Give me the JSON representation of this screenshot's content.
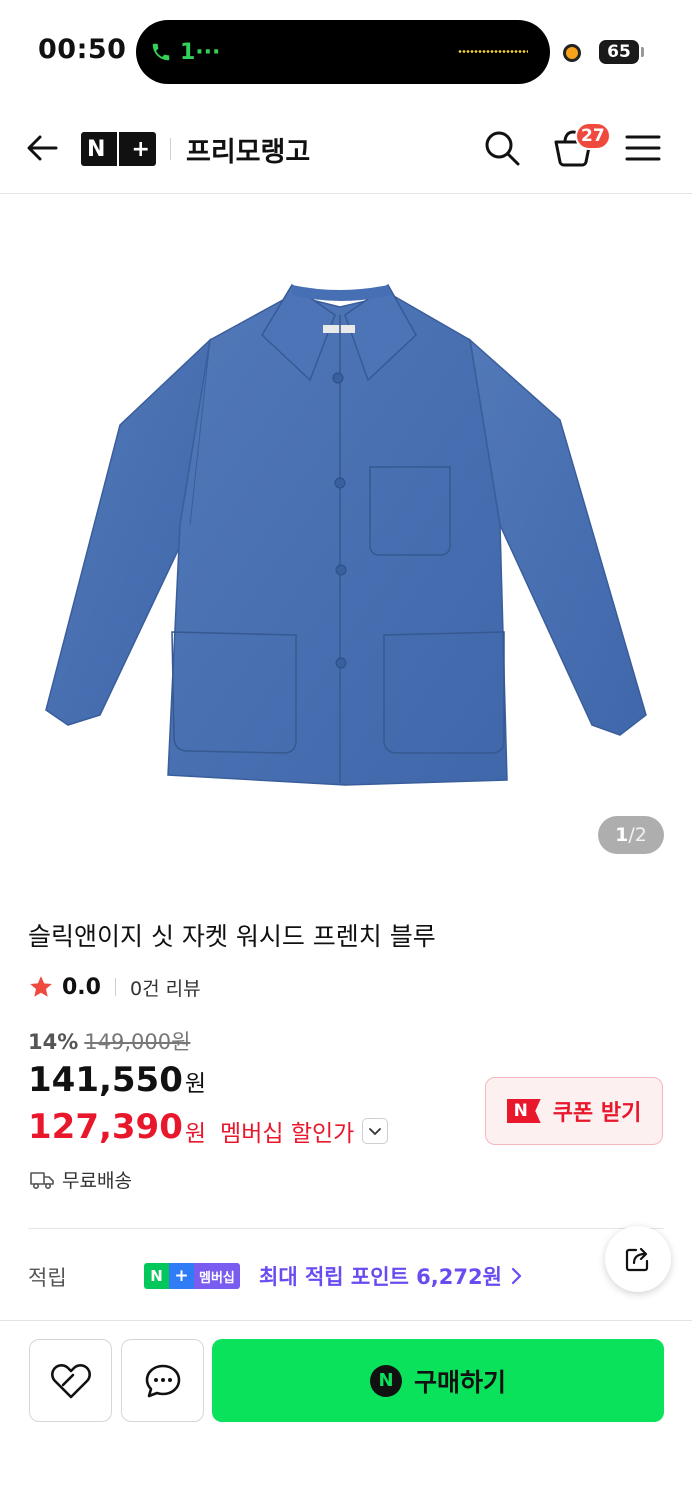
{
  "status_bar": {
    "time": "00:50",
    "call_indicator": "1···",
    "battery": "65",
    "icons": [
      "phone-icon",
      "battery-icon"
    ]
  },
  "header": {
    "logo_text": "N+",
    "logo_n": "N",
    "logo_plus": "+",
    "store_name": "프리모랭고",
    "cart_count": "27",
    "icons": [
      "back-arrow-icon",
      "search-icon",
      "cart-icon",
      "menu-icon"
    ]
  },
  "product": {
    "image_counter": {
      "current": "1",
      "separator": "/",
      "total": "2"
    },
    "title": "슬릭앤이지 싯 자켓 워시드 프렌치 블루",
    "rating": "0.0",
    "review_count": "0건 리뷰",
    "discount_rate": "14%",
    "original_price": "149,000원",
    "sale_price": "141,550",
    "currency": "원",
    "member_price": "127,390",
    "member_label": "멤버십 할인가",
    "shipping": "무료배송",
    "colors": {
      "member_red": "#e8172c",
      "jacket_blue": "#4a72b4",
      "buy_green": "#0be25b"
    }
  },
  "coupon": {
    "n_mark": "N",
    "label": "쿠폰 받기"
  },
  "points": {
    "label": "적립",
    "badge_n": "N",
    "badge_plus": "+",
    "badge_text": "멤버십",
    "text": "최대 적립 포인트 6,272원"
  },
  "bottom_bar": {
    "buy_n": "N",
    "buy_label": "구매하기",
    "icons": [
      "wishlist-heart-icon",
      "chat-bubble-icon",
      "share-icon"
    ]
  }
}
